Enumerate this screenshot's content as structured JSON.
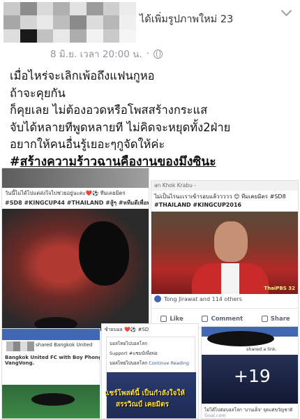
{
  "header": {
    "title": "ได้เพิ่มรูปภาพใหม่ 23",
    "date": "8 มิ.ย. เวลา 20:00 น.",
    "separator": "·"
  },
  "post": {
    "lines": [
      "เมื่อไหร่จะเลิกเพ้อถึงแฟนกูหอ",
      "ถ้าจะคุยกัน",
      "ก็คุยเลย ไม่ต้องอวดหรือโพสสร้างกระแส",
      "จับได้หลายทีพูดหลายที ไม่คิดจะหยุดทั้ง2ฝ่าย",
      "อยากให้คนอื่นรู้เยอะๆกูจัดให้ค่ะ"
    ],
    "hashtag_prefix": "#",
    "hashtag_text": "สร้างความร้าวฉานคืองานของมึงซินะ"
  },
  "card_left": {
    "caption1": "วันนี้ไม่ได้ไปแต่ส่งใจไปช่วยอยู่นะคะ❤️⚽ ทีมเคยมิตร",
    "caption2": "#SD8 #KINGCUP44 #THAILAND #สู้ๆ #หทีมตีเพื่อพ่อ"
  },
  "card_right": {
    "page_name": "an Khok Krabu -",
    "caption1": "ไม่เป็นไรนะเราเข้ารอบแล้ววววว 😊 ทีมเคยมิตร #SD8",
    "caption2": "#THAILAND #KINGCUP2016",
    "broadcaster": "ThaiPBS 32",
    "likes_text": "Tong Jirawat and 114 others",
    "actions": [
      "Like",
      "Comment",
      "Share"
    ]
  },
  "card_b1": {
    "line1": "shared Bangkok United",
    "line2": "Bangkok United FC with Boy Phongsathon",
    "line3": "VangVong."
  },
  "card_b2": {
    "top": "ซ้ายบอล ❤️⚽ #SD",
    "inner1": "บอลไทยไปบอลโลก",
    "inner2": "Support #แชมป์เพื่อพ่อ",
    "inner3": "บอลไทยไปบอลโลก",
    "inner3_link": "Continue Reading",
    "overlay1": "แชร์โพสต์นี้ เป็นกำลังใจให้",
    "overlay2": "สรรวิณป์ เคยมิตร"
  },
  "card_b3": {
    "shared": "shared a link.",
    "more_count": "+19",
    "caption": "ไม่ได้ไปต่อบอลโลก 'บานเด็จ' จุดแต่ขวัญชาติ",
    "domain": "Goal.com"
  }
}
